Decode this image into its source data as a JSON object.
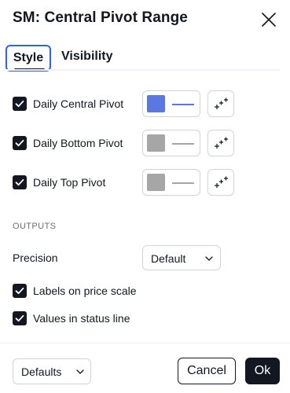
{
  "dialog": {
    "title": "SM: Central Pivot Range",
    "close_icon": "close-icon"
  },
  "tabs": [
    {
      "label": "Style",
      "active": true
    },
    {
      "label": "Visibility",
      "active": false
    }
  ],
  "plots": [
    {
      "label": "Daily Central Pivot",
      "checked": true,
      "color": "#5b78e0",
      "line_color": "#5b78e0"
    },
    {
      "label": "Daily Bottom Pivot",
      "checked": true,
      "color": "#a6a6a6",
      "line_color": "#a6a6a6"
    },
    {
      "label": "Daily Top Pivot",
      "checked": true,
      "color": "#a6a6a6",
      "line_color": "#a6a6a6"
    }
  ],
  "outputs": {
    "section_title": "OUTPUTS",
    "precision_label": "Precision",
    "precision_value": "Default",
    "labels_on_price_scale": {
      "label": "Labels on price scale",
      "checked": true
    },
    "values_in_status_line": {
      "label": "Values in status line",
      "checked": true
    }
  },
  "footer": {
    "defaults_label": "Defaults",
    "cancel_label": "Cancel",
    "ok_label": "Ok"
  },
  "colors": {
    "accent": "#2962ff",
    "text": "#131722",
    "border": "#d1d4dc",
    "ok_bg": "#131722"
  }
}
